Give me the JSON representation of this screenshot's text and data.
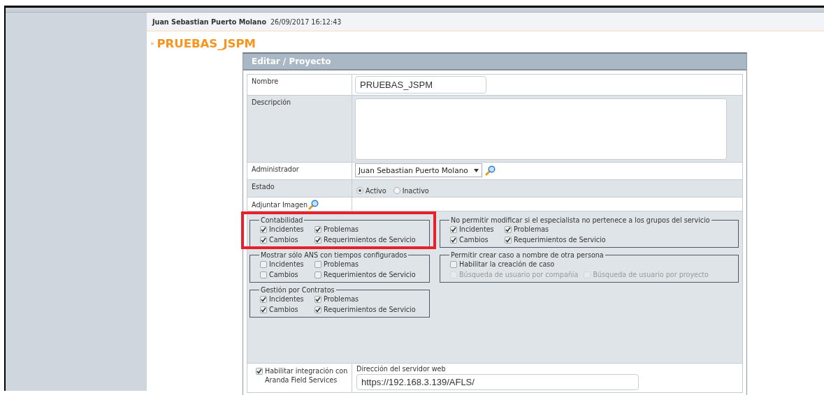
{
  "header": {
    "user": "Juan Sebastian Puerto Molano",
    "timestamp": "26/09/2017 16:12:43"
  },
  "page_title": {
    "marker": "»",
    "text": "PRUEBAS_JSPM"
  },
  "dialog": {
    "title": "Editar / Proyecto",
    "nombre": {
      "label": "Nombre",
      "value": "PRUEBAS_JSPM"
    },
    "descripcion": {
      "label": "Descripción"
    },
    "administrador": {
      "label": "Administrador",
      "value": "Juan Sebastian Puerto Molano"
    },
    "estado": {
      "label": "Estado",
      "options": [
        {
          "label": "Activo",
          "selected": true
        },
        {
          "label": "Inactivo",
          "selected": false
        }
      ]
    },
    "adjuntar": {
      "label": "Adjuntar Imagen"
    },
    "groups_left": [
      {
        "legend": "Contabilidad",
        "highlighted": true,
        "rows": [
          [
            {
              "label": "Incidentes",
              "checked": true,
              "disabled": false
            },
            {
              "label": "Problemas",
              "checked": true,
              "disabled": false
            }
          ],
          [
            {
              "label": "Cambios",
              "checked": true,
              "disabled": false
            },
            {
              "label": "Requerimientos de Servicio",
              "checked": true,
              "disabled": false
            }
          ]
        ]
      },
      {
        "legend": "Mostrar sólo ANS con tiempos configurados",
        "highlighted": false,
        "rows": [
          [
            {
              "label": "Incidentes",
              "checked": false,
              "disabled": false
            },
            {
              "label": "Problemas",
              "checked": false,
              "disabled": false
            }
          ],
          [
            {
              "label": "Cambios",
              "checked": false,
              "disabled": false
            },
            {
              "label": "Requerimientos de Servicio",
              "checked": false,
              "disabled": false
            }
          ]
        ]
      },
      {
        "legend": "Gestión por Contratos",
        "highlighted": false,
        "rows": [
          [
            {
              "label": "Incidentes",
              "checked": true,
              "disabled": false
            },
            {
              "label": "Problemas",
              "checked": true,
              "disabled": false
            }
          ],
          [
            {
              "label": "Cambios",
              "checked": true,
              "disabled": false
            },
            {
              "label": "Requerimientos de Servicio",
              "checked": true,
              "disabled": false
            }
          ]
        ]
      }
    ],
    "groups_right": [
      {
        "legend": "No permitir modificar si el especialista no pertenece a los grupos del servicio",
        "highlighted": false,
        "rows": [
          [
            {
              "label": "Incidentes",
              "checked": true,
              "disabled": false
            },
            {
              "label": "Problemas",
              "checked": true,
              "disabled": false
            }
          ],
          [
            {
              "label": "Cambios",
              "checked": true,
              "disabled": false
            },
            {
              "label": "Requerimientos de Servicio",
              "checked": true,
              "disabled": false
            }
          ]
        ]
      },
      {
        "legend": "Permitir crear caso a nombre de otra persona",
        "highlighted": false,
        "rows": [
          [
            {
              "label": "Habilitar la creación de caso",
              "checked": false,
              "disabled": false
            }
          ],
          [
            {
              "label": "Búsqueda de usuario por compañía",
              "checked": false,
              "disabled": true
            },
            {
              "label": "Búsqueda de usuario por proyecto",
              "checked": false,
              "disabled": true
            }
          ]
        ]
      }
    ],
    "integracion": {
      "label": "Habilitar integración con Aranda Field Services",
      "checked": true,
      "server_label": "Dirección del servidor web",
      "server_value": "https://192.168.3.139/AFLS/"
    }
  }
}
